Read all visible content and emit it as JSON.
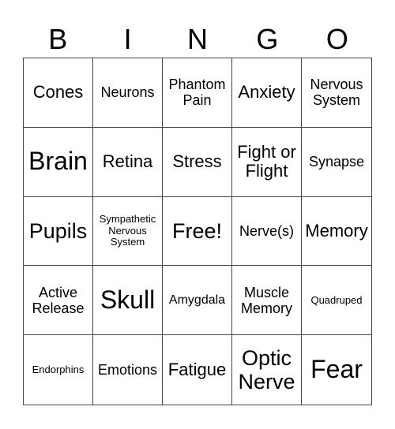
{
  "header": [
    "B",
    "I",
    "N",
    "G",
    "O"
  ],
  "cells": [
    "Cones",
    "Neurons",
    "Phantom Pain",
    "Anxiety",
    "Nervous System",
    "Brain",
    "Retina",
    "Stress",
    "Fight or Flight",
    "Synapse",
    "Pupils",
    "Sympathetic Nervous System",
    "Free!",
    "Nerve(s)",
    "Memory",
    "Active Release",
    "Skull",
    "Amygdala",
    "Muscle Memory",
    "Quadruped",
    "Endorphins",
    "Emotions",
    "Fatigue",
    "Optic Nerve",
    "Fear"
  ]
}
